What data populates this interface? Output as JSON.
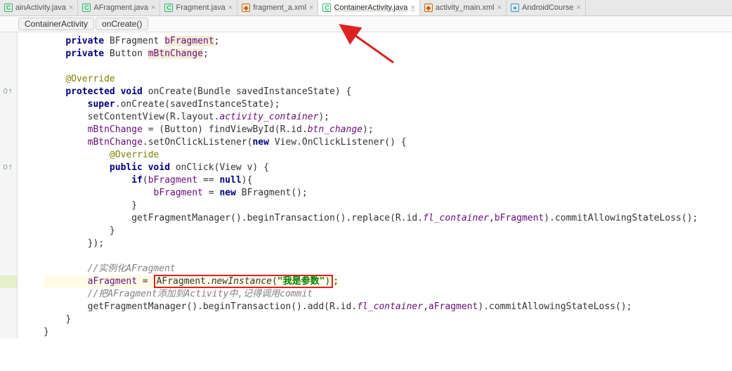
{
  "tabs": [
    {
      "label": "ainActivity.java",
      "icon": "C",
      "cls": "ic-c"
    },
    {
      "label": "AFragment.java",
      "icon": "C",
      "cls": "ic-c"
    },
    {
      "label": "Fragment.java",
      "icon": "C",
      "cls": "ic-c"
    },
    {
      "label": "fragment_a.xml",
      "icon": "◆",
      "cls": "ic-x"
    },
    {
      "label": "ContainerActivity.java",
      "icon": "C",
      "cls": "ic-c",
      "active": true
    },
    {
      "label": "activity_main.xml",
      "icon": "◆",
      "cls": "ic-x"
    },
    {
      "label": "AndroidCourse",
      "icon": "●",
      "cls": "ic-r"
    }
  ],
  "breadcrumb": [
    "ContainerActivity",
    "onCreate()"
  ],
  "code": {
    "l1a": "private",
    "l1b": " BFragment ",
    "l1c": "bFragment",
    "l1d": ";",
    "l2a": "private",
    "l2b": " Button ",
    "l2c": "mBtnChange",
    "l2d": ";",
    "l4": "@Override",
    "l5a": "protected void",
    "l5b": " onCreate(Bundle savedInstanceState) {",
    "l6a": "super",
    "l6b": ".onCreate(savedInstanceState);",
    "l7a": "setContentView(R.layout.",
    "l7b": "activity_container",
    "l7c": ");",
    "l8a": "mBtnChange",
    "l8b": " = (Button) findViewById(R.id.",
    "l8c": "btn_change",
    "l8d": ");",
    "l9a": "mBtnChange",
    "l9b": ".setOnClickListener(",
    "l9c": "new",
    "l9d": " View.OnClickListener() {",
    "l10": "@Override",
    "l11a": "public void",
    "l11b": " onClick(View v) {",
    "l12a": "if",
    "l12b": "(",
    "l12c": "bFragment",
    "l12d": " == ",
    "l12e": "null",
    "l12f": "){",
    "l13a": "bFragment",
    "l13b": " = ",
    "l13c": "new",
    "l13d": " BFragment();",
    "l14": "}",
    "l15a": "getFragmentManager().beginTransaction().replace(R.id.",
    "l15b": "fl_container",
    "l15c": ",",
    "l15d": "bFragment",
    "l15e": ").commitAllowingStateLoss();",
    "l16": "}",
    "l17": "});",
    "l19": "//实例化AFragment",
    "l20a": "aFragment",
    "l20b": " = ",
    "l20c": "AFragment.",
    "l20d": "newInstance",
    "l20e": "(",
    "l20f": "\"我是参数\"",
    "l20g": ")",
    "l20h": ";",
    "l21": "//把AFragment添加到Activity中,记得调用commit",
    "l22a": "getFragmentManager().beginTransaction().add(R.id.",
    "l22b": "fl_container",
    "l22c": ",",
    "l22d": "aFragment",
    "l22e": ").commitAllowingStateLoss();",
    "l23": "}",
    "l24": "}"
  }
}
